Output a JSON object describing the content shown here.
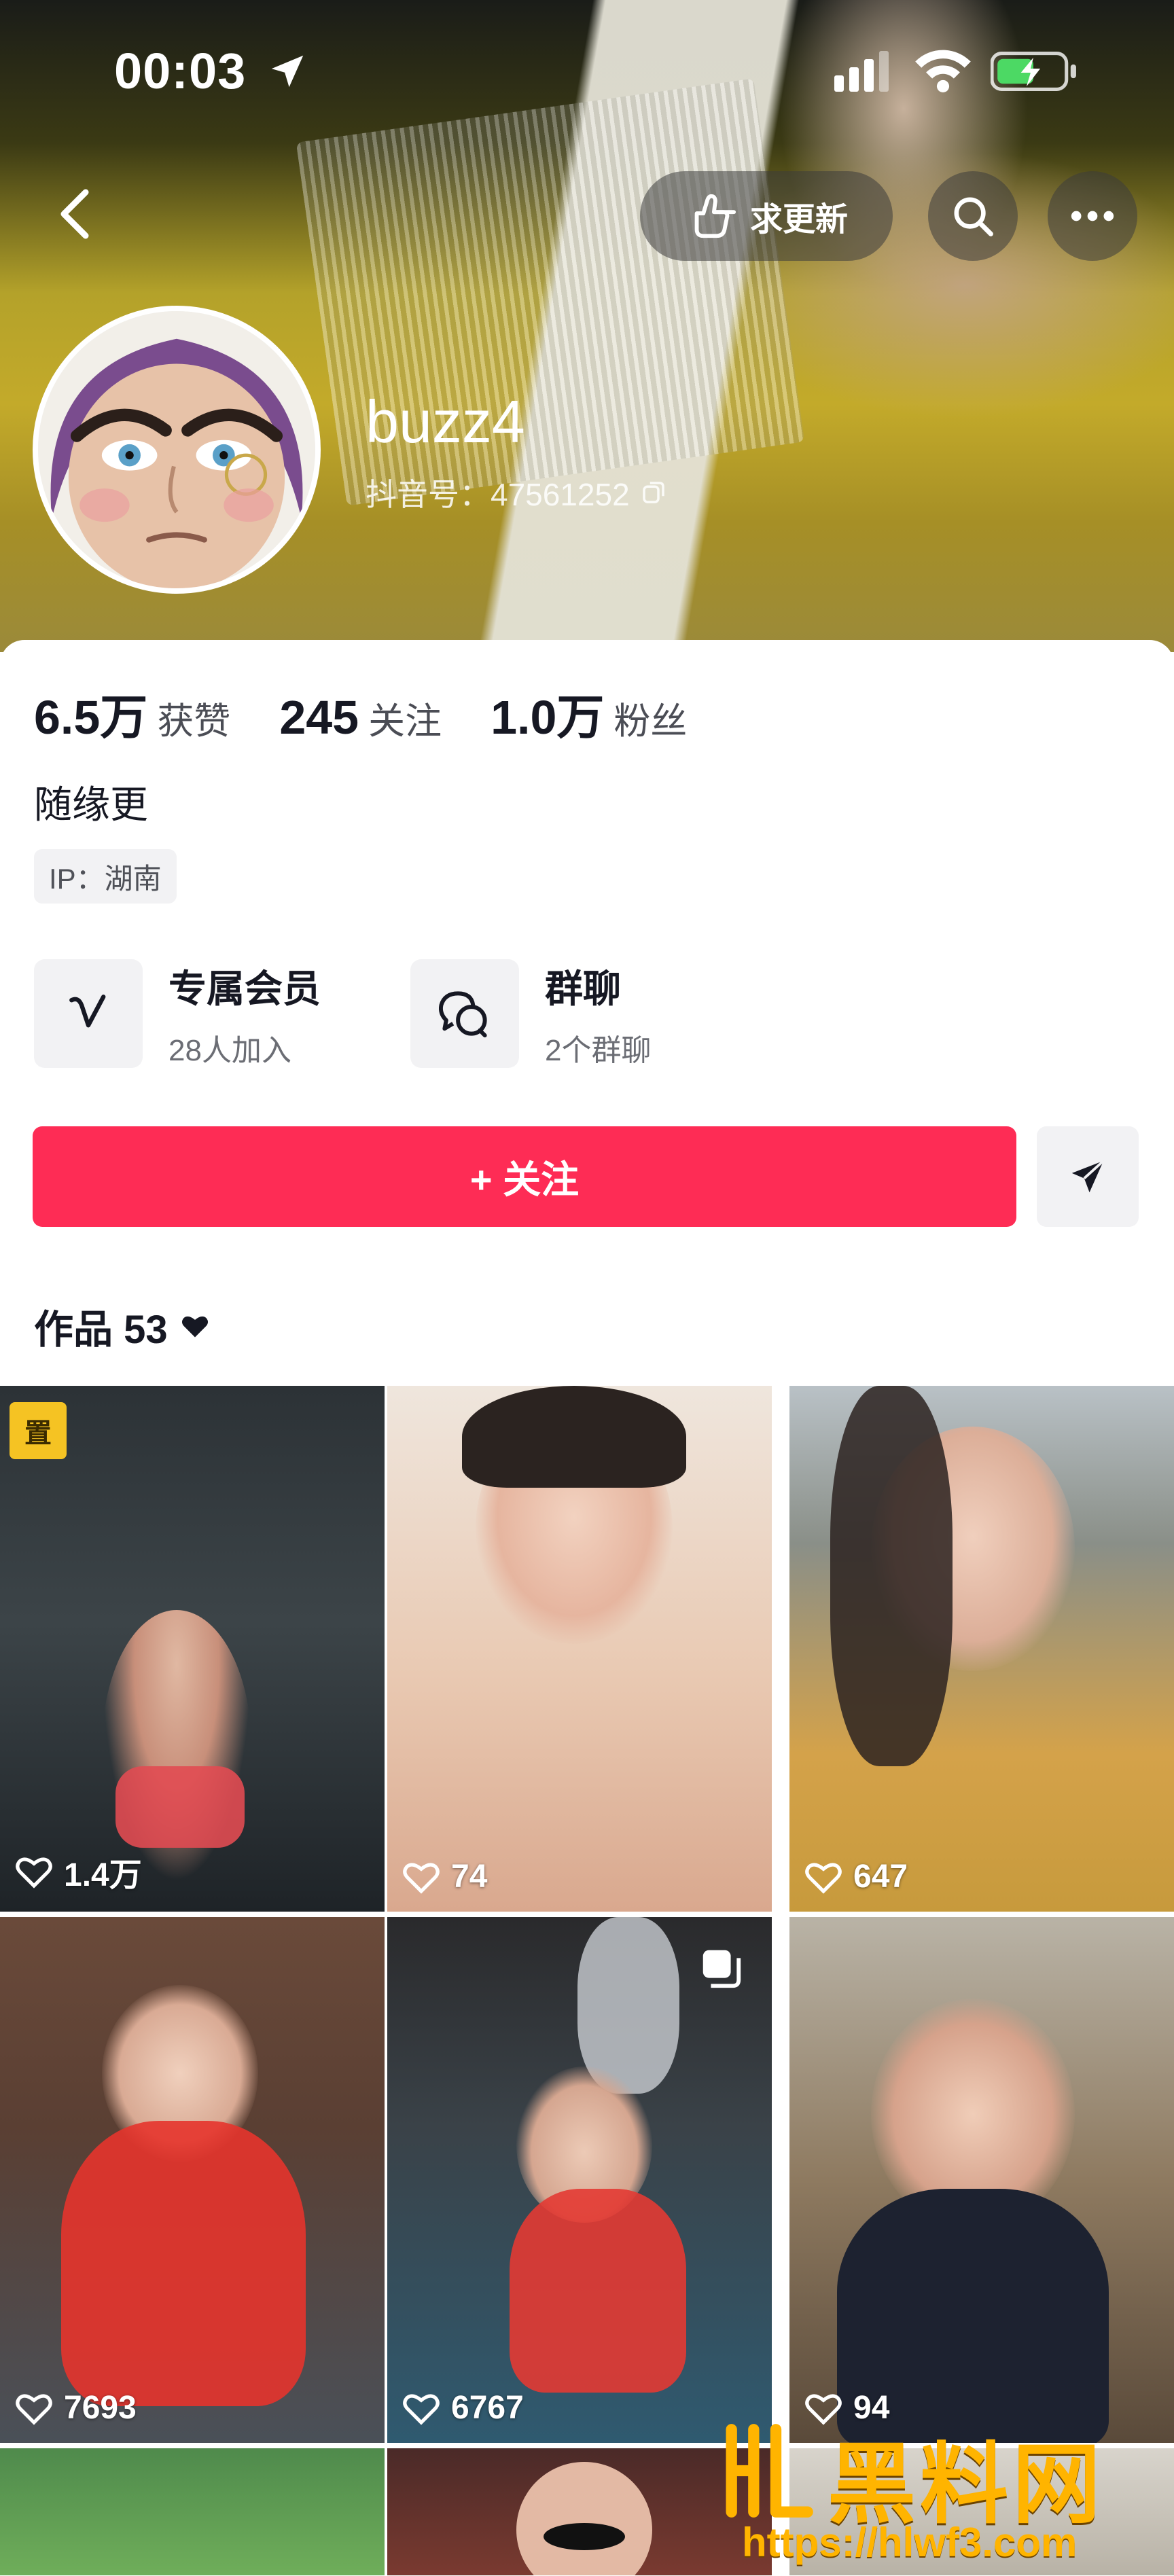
{
  "status_bar": {
    "time": "00:03"
  },
  "header": {
    "update_label": "求更新"
  },
  "profile": {
    "username": "buzz4",
    "douyin_id": "抖音号：47561252",
    "stats": [
      {
        "value": "6.5万",
        "label": "获赞"
      },
      {
        "value": "245",
        "label": "关注"
      },
      {
        "value": "1.0万",
        "label": "粉丝"
      }
    ],
    "bio": "随缘更",
    "ip": "IP：湖南"
  },
  "features": {
    "member": {
      "title": "专属会员",
      "subtitle": "28人加入"
    },
    "group": {
      "title": "群聊",
      "subtitle": "2个群聊"
    }
  },
  "actions": {
    "follow_label": "+ 关注"
  },
  "works": {
    "label": "作品 53"
  },
  "grid": {
    "tiles": [
      {
        "likes": "1.4万",
        "bg": "dark-water-red"
      },
      {
        "likes": "74",
        "bg": "peach"
      },
      {
        "likes": "647",
        "bg": "yellow-street"
      },
      {
        "likes": "7693",
        "bg": "red-wood"
      },
      {
        "likes": "6767",
        "bg": "red-pool"
      },
      {
        "likes": "94",
        "bg": "navy-cafe"
      },
      {
        "likes": "",
        "bg": "green"
      },
      {
        "likes": "",
        "bg": "dark-red"
      },
      {
        "likes": "",
        "bg": "light"
      }
    ]
  },
  "watermark": {
    "brand": "黑料网",
    "url": "https://hlwf3.com"
  },
  "colors": {
    "accent": "#fe2c55",
    "text": "#161823",
    "muted": "#6b6d74",
    "chip_bg": "#f2f2f4",
    "watermark": "#ffb400"
  }
}
